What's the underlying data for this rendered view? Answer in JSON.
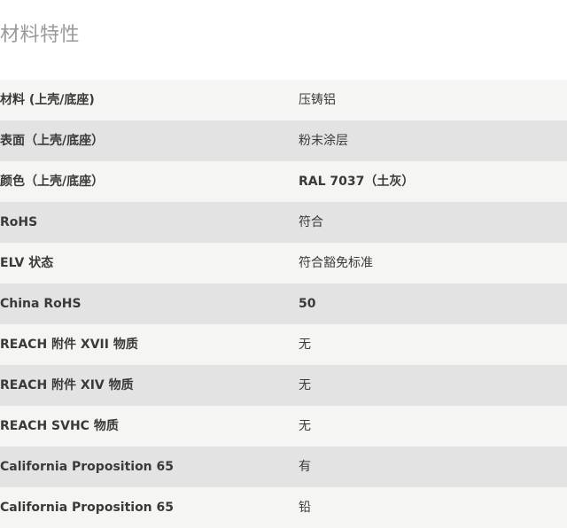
{
  "section": {
    "title": "材料特性"
  },
  "rows": [
    {
      "label": "材料 (上壳/底座)",
      "value": "压铸铝"
    },
    {
      "label": "表面（上壳/底座）",
      "value": "粉末涂层"
    },
    {
      "label": "颜色（上壳/底座）",
      "value": "RAL 7037（土灰）"
    },
    {
      "label": "RoHS",
      "value": "符合"
    },
    {
      "label": "ELV 状态",
      "value": "符合豁免标准"
    },
    {
      "label": "China RoHS",
      "value": "50"
    },
    {
      "label": "REACH 附件 XVII 物质",
      "value": "无"
    },
    {
      "label": "REACH 附件 XIV 物质",
      "value": "无"
    },
    {
      "label": "REACH SVHC 物质",
      "value": "无"
    },
    {
      "label": "California Proposition 65",
      "value": "有"
    },
    {
      "label": "California Proposition 65",
      "value": "铅"
    }
  ]
}
